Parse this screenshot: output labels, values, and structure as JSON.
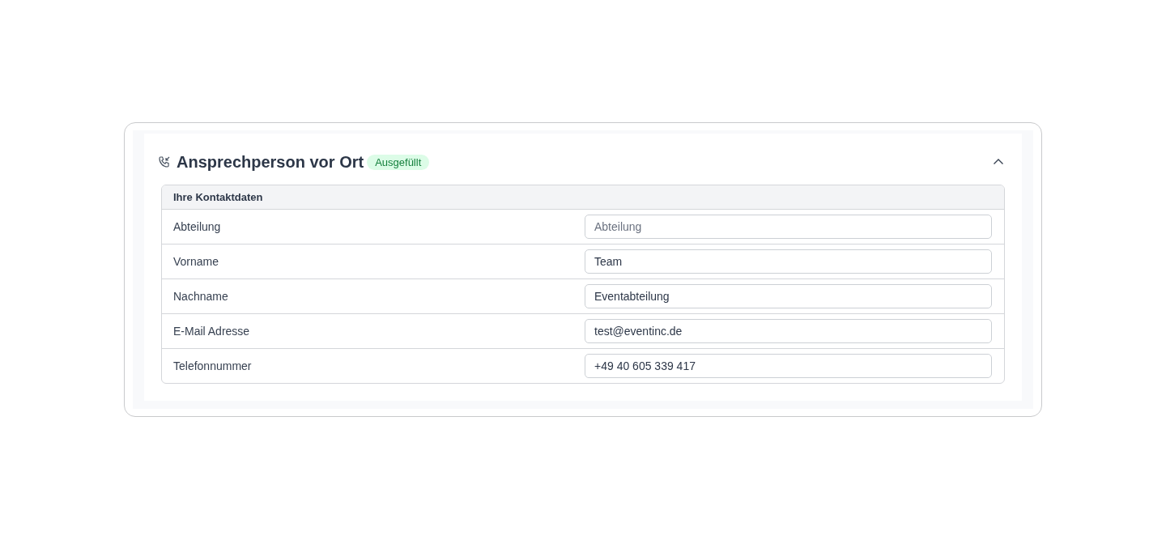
{
  "section": {
    "title": "Ansprechperson vor Ort",
    "status_badge": "Ausgefüllt",
    "expanded": true,
    "table": {
      "heading": "Ihre Kontaktdaten",
      "rows": [
        {
          "label": "Abteilung",
          "placeholder": "Abteilung"
        },
        {
          "label": "Vorname",
          "value": "Team"
        },
        {
          "label": "Nachname",
          "value": "Eventabteilung"
        },
        {
          "label": "E-Mail Adresse",
          "value": "test@eventinc.de"
        },
        {
          "label": "Telefonnummer",
          "value": "+49 40 605 339 417"
        }
      ]
    }
  }
}
